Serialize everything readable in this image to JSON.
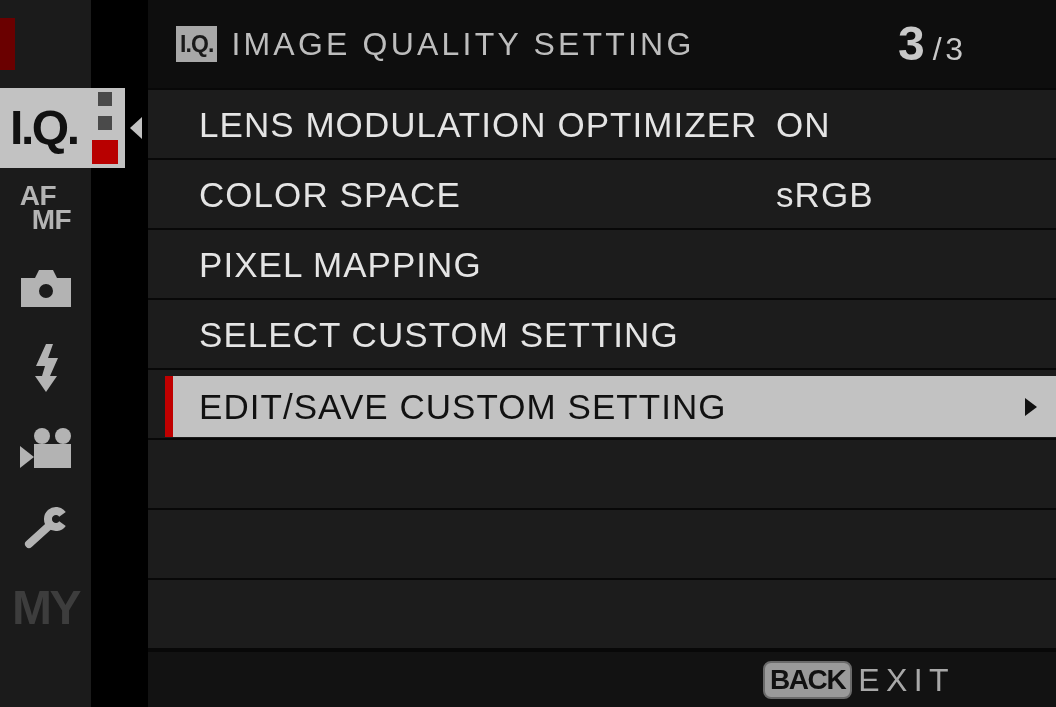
{
  "sidebar": {
    "items": [
      {
        "kind": "text",
        "label": "I.Q.",
        "selected": true,
        "disabled": false
      },
      {
        "kind": "stacked",
        "lines": [
          "AF",
          "MF"
        ],
        "selected": false,
        "disabled": false
      },
      {
        "kind": "icon",
        "selected": false,
        "disabled": false
      },
      {
        "kind": "icon",
        "selected": false,
        "disabled": false
      },
      {
        "kind": "icon",
        "selected": false,
        "disabled": false
      },
      {
        "kind": "icon",
        "selected": false,
        "disabled": false
      },
      {
        "kind": "text",
        "label": "MY",
        "selected": false,
        "disabled": true
      }
    ],
    "page_dots": [
      {
        "selected": false
      },
      {
        "selected": false
      },
      {
        "selected": true
      }
    ]
  },
  "header": {
    "badge": "I.Q.",
    "title": "IMAGE QUALITY SETTING",
    "page_current": "3",
    "page_total": "/3"
  },
  "rows": [
    {
      "label": "LENS MODULATION OPTIMIZER",
      "value": "ON",
      "selected": false,
      "submenu": false
    },
    {
      "label": "COLOR SPACE",
      "value": "sRGB",
      "selected": false,
      "submenu": false
    },
    {
      "label": "PIXEL MAPPING",
      "selected": false,
      "submenu": false
    },
    {
      "label": "SELECT CUSTOM SETTING",
      "selected": false,
      "submenu": false
    },
    {
      "label": "EDIT/SAVE CUSTOM SETTING",
      "selected": true,
      "submenu": true
    }
  ],
  "footer": {
    "key": "BACK",
    "action": "EXIT"
  }
}
